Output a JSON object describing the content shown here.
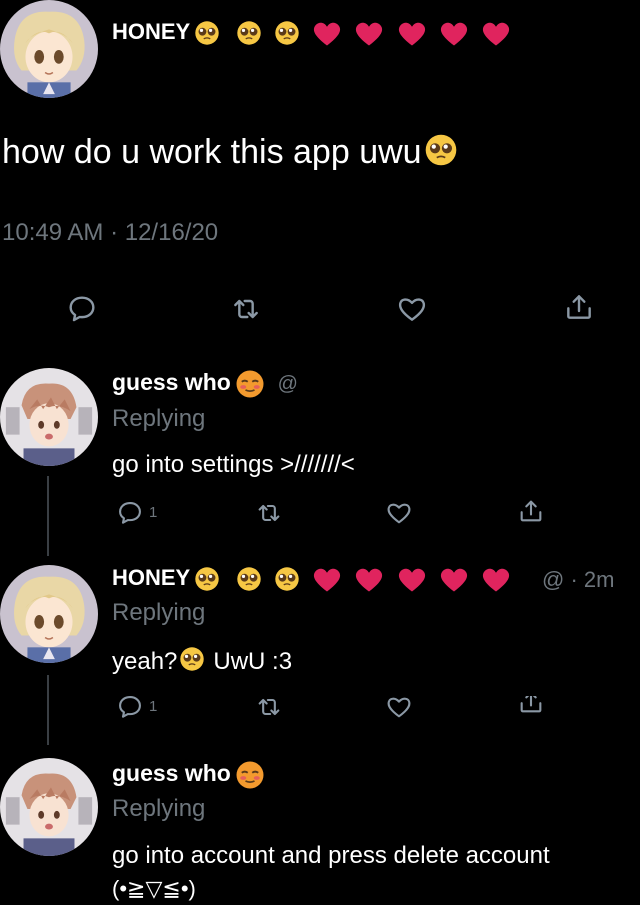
{
  "main_tweet": {
    "author_name": "HONEY",
    "text": "how do u work this app uwu",
    "timestamp": "10:49 AM · 12/16/20"
  },
  "replies": [
    {
      "author_name": "guess who",
      "handle_fragment": "@",
      "replying": "Replying",
      "text": "go into settings >///////<",
      "reply_count": "1"
    },
    {
      "author_name": "HONEY",
      "meta": "@ · 2m",
      "replying": "Replying",
      "text_a": "yeah?",
      "text_b": "UwU :3",
      "reply_count": "1"
    },
    {
      "author_name": "guess who",
      "replying": "Replying",
      "text": "go into account and press delete account",
      "text_2": "(•≧▽≦•)"
    }
  ],
  "icons": [
    "reply-icon",
    "retweet-icon",
    "like-icon",
    "share-icon"
  ],
  "colors": {
    "background": "#000000",
    "secondary": "#6e767d",
    "heart": "#e0245e"
  }
}
